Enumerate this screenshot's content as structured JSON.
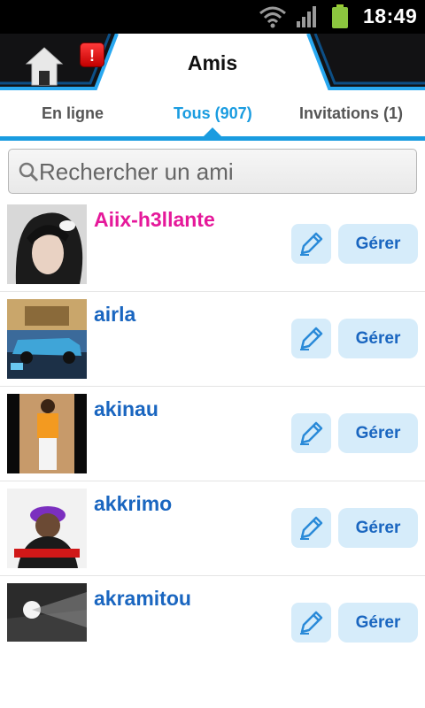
{
  "status_bar": {
    "time": "18:49",
    "icons": [
      "wifi-icon",
      "signal-icon",
      "battery-icon"
    ]
  },
  "header": {
    "title": "Amis",
    "home_icon": "home-icon",
    "badge": "!"
  },
  "tabs": [
    {
      "label": "En ligne",
      "active": false
    },
    {
      "label": "Tous (907)",
      "active": true
    },
    {
      "label": "Invitations (1)",
      "active": false
    }
  ],
  "search": {
    "placeholder": "Rechercher un ami",
    "value": "",
    "icon": "search-icon"
  },
  "friends": [
    {
      "name": "Aiix-h3llante",
      "highlight": true,
      "manage_label": "Gérer",
      "edit_icon": "pencil-icon"
    },
    {
      "name": "airla",
      "highlight": false,
      "manage_label": "Gérer",
      "edit_icon": "pencil-icon"
    },
    {
      "name": "akinau",
      "highlight": false,
      "manage_label": "Gérer",
      "edit_icon": "pencil-icon"
    },
    {
      "name": "akkrimo",
      "highlight": false,
      "manage_label": "Gérer",
      "edit_icon": "pencil-icon"
    },
    {
      "name": "akramitou",
      "highlight": false,
      "manage_label": "Gérer",
      "edit_icon": "pencil-icon"
    }
  ],
  "colors": {
    "accent": "#1a9ce0",
    "name": "#1a66c0",
    "highlight_name": "#e5189a",
    "button_bg": "#d6ecfa",
    "badge": "#e00000"
  }
}
